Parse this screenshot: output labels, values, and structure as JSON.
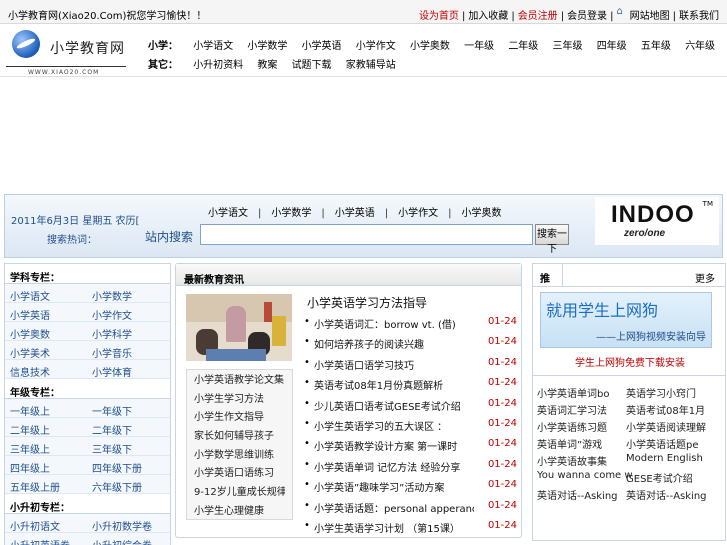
{
  "topbar": {
    "slogan": "小学教育网(Xiao20.Com)祝您学习愉快！！",
    "links": [
      {
        "label": "设为首页",
        "red": true
      },
      {
        "label": "加入收藏",
        "red": false
      },
      {
        "label": "会员注册",
        "red": true
      },
      {
        "label": "会员登录",
        "red": false
      },
      {
        "label": "网站地图",
        "red": false,
        "icon": "home-icon"
      },
      {
        "label": "联系我们",
        "red": false
      }
    ]
  },
  "logo": {
    "text": "小学教育网",
    "url": "WWW.XIAO20.COM"
  },
  "nav": {
    "row1_head": "小学：",
    "row1": [
      "小学语文",
      "小学数学",
      "小学英语",
      "小学作文",
      "小学奥数",
      "一年级",
      "二年级",
      "三年级",
      "四年级",
      "五年级",
      "六年级"
    ],
    "row2_head": "其它：",
    "row2": [
      "小升初资料",
      "教案",
      "试题下载",
      "家教辅导站"
    ]
  },
  "search": {
    "date": "2011年6月3日 星期五 农历[",
    "subnav_label": "搜索热词：",
    "quick_links": [
      "小学语文",
      "小学数学",
      "小学英语",
      "小学作文",
      "小学奥数"
    ],
    "label": "站内搜索",
    "input_value": "",
    "button": "搜索一下"
  },
  "brand": {
    "main": "INDOO",
    "tm": "TM",
    "tagline": "zero/one"
  },
  "left": {
    "sections": [
      {
        "title": "学科专栏：",
        "rows": [
          [
            "小学语文",
            "小学数学"
          ],
          [
            "小学英语",
            "小学作文"
          ],
          [
            "小学奥数",
            "小学科学"
          ],
          [
            "小学美术",
            "小学音乐"
          ],
          [
            "信息技术",
            "小学体育"
          ]
        ]
      },
      {
        "title": "年级专栏：",
        "rows": [
          [
            "一年级上",
            "一年级下"
          ],
          [
            "二年级上",
            "二年级下"
          ],
          [
            "三年级上",
            "三年级下"
          ],
          [
            "四年级上",
            "四年级下册"
          ],
          [
            "五年级上册",
            "六年级下册"
          ]
        ]
      },
      {
        "title": "小升初专栏：",
        "rows": [
          [
            "小升初语文",
            "小升初数学卷"
          ],
          [
            "小升初英语卷",
            "小升初综合卷"
          ]
        ]
      }
    ]
  },
  "middle": {
    "title": "最新教育资讯",
    "sub_list": [
      "小学英语教学论文集",
      "小学生学习方法",
      "小学生作文指导",
      "家长如何辅导孩子",
      "小学数学思维训练",
      "小学英语口语练习",
      "9-12岁儿童成长规律",
      "小学生心理健康"
    ],
    "headline": "小学英语学习方法指导",
    "news": [
      {
        "title": "小学英语词汇：borrow vt. (借)",
        "date": "01-24"
      },
      {
        "title": "如何培养孩子的阅读兴趣",
        "date": "01-24"
      },
      {
        "title": "小学英语口语学习技巧",
        "date": "01-24"
      },
      {
        "title": "英语考试08年1月份真题解析",
        "date": "01-24"
      },
      {
        "title": "少儿英语口语考试GESE考试介绍",
        "date": "01-24"
      },
      {
        "title": "小学生英语学习的五大误区 ：",
        "date": "01-24"
      },
      {
        "title": "小学英语教学设计方案 第一课时",
        "date": "01-24"
      },
      {
        "title": "小学英语单词 记忆方法 经验分享",
        "date": "01-24"
      },
      {
        "title": "小学英语”趣味学习”活动方案",
        "date": "01-24"
      },
      {
        "title": "小学英语话题：personal apperance",
        "date": "01-24"
      },
      {
        "title": "小学生英语学习计划 （第15课）",
        "date": "01-24"
      }
    ]
  },
  "right": {
    "tab": "推荐",
    "more": "更多",
    "banner_line1": "就用学生上网狗",
    "banner_line2": "——上网狗视频安装向导",
    "ad_link": "学生上网狗免费下载安装",
    "items": [
      [
        "小学英语单词bo",
        "英语学习小窍门"
      ],
      [
        "英语词汇学习法",
        "英语考试08年1月"
      ],
      [
        "小学英语练习题",
        "小学英语阅读理解"
      ],
      [
        "英语单词”游戏",
        "小学英语话题pe"
      ],
      [
        "小学英语故事集",
        "Modern English"
      ],
      [
        "You wanna come w",
        "GESE考试介绍"
      ],
      [
        "英语对话--Asking",
        "英语对话--Asking"
      ]
    ]
  }
}
